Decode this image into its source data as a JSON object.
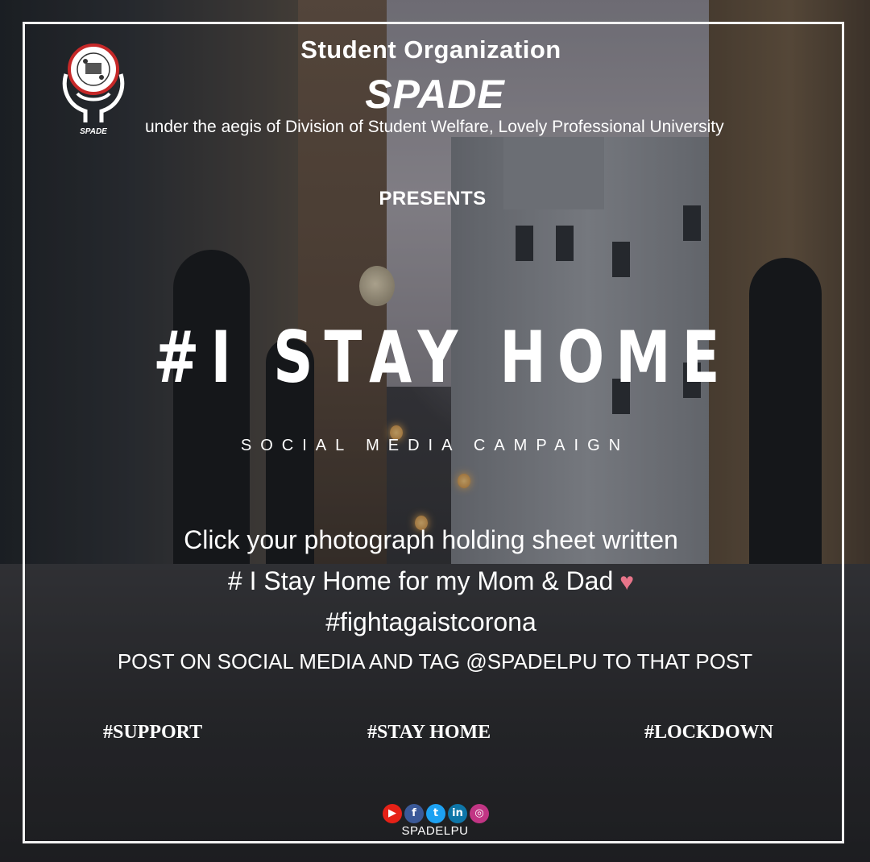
{
  "header": {
    "org_line": "Student Organization",
    "org_name": "SPADE",
    "aegis": "under the aegis of Division of Student Welfare, Lovely Professional University",
    "presents": "PRESENTS",
    "logo_text": "SPADE"
  },
  "campaign": {
    "title": "#I STAY HOME",
    "subtitle": "SOCIAL MEDIA CAMPAIGN"
  },
  "instructions": {
    "line1": "Click your photograph holding sheet written",
    "line2": "# I Stay Home for my Mom & Dad",
    "line3": "#fightagaistcorona",
    "line4": "POST ON SOCIAL MEDIA AND TAG @SPADELPU TO THAT POST"
  },
  "hashtags": [
    "#SUPPORT",
    "#STAY HOME",
    "#LOCKDOWN"
  ],
  "social": {
    "icons": [
      {
        "name": "youtube-icon",
        "glyph": "▶",
        "color": "#e62117"
      },
      {
        "name": "facebook-icon",
        "glyph": "f",
        "color": "#3b5998"
      },
      {
        "name": "twitter-icon",
        "glyph": "t",
        "color": "#1da1f2"
      },
      {
        "name": "linkedin-icon",
        "glyph": "in",
        "color": "#0e76a8"
      },
      {
        "name": "instagram-icon",
        "glyph": "◎",
        "color": "#c13584"
      }
    ],
    "handle": "SPADELPU"
  },
  "colors": {
    "frame": "#f2f2f2",
    "heart": "#e8758a",
    "text": "#ffffff"
  }
}
